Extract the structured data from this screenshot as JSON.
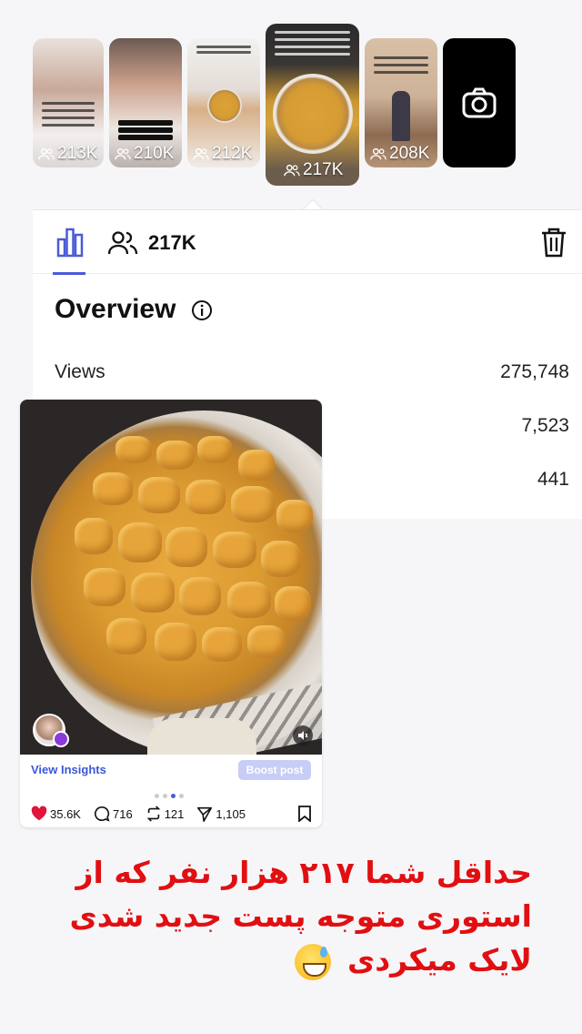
{
  "stories": [
    {
      "views": "213K"
    },
    {
      "views": "210K"
    },
    {
      "views": "212K"
    },
    {
      "views": "217K",
      "selected": true
    },
    {
      "views": "208K"
    }
  ],
  "camera_tile": {
    "icon": "camera-icon"
  },
  "insights": {
    "reach_value": "217K",
    "overview_title": "Overview",
    "rows": [
      {
        "label": "Views",
        "value": "275,748"
      },
      {
        "label": "",
        "value": "7,523"
      },
      {
        "label": "",
        "value": "441"
      }
    ]
  },
  "post": {
    "view_insights": "View Insights",
    "boost_label": "Boost post",
    "likes": "35.6K",
    "comments": "716",
    "reposts": "121",
    "shares": "1,105"
  },
  "caption": {
    "text": "حداقل شما ۲۱۷ هزار نفر که از استوری متوجه پست جدید شدی لایک میکردی",
    "color": "#e10f12"
  },
  "colors": {
    "accent": "#4a5bd6",
    "like": "#e0143c",
    "boost_bg": "#c7cdf6"
  }
}
